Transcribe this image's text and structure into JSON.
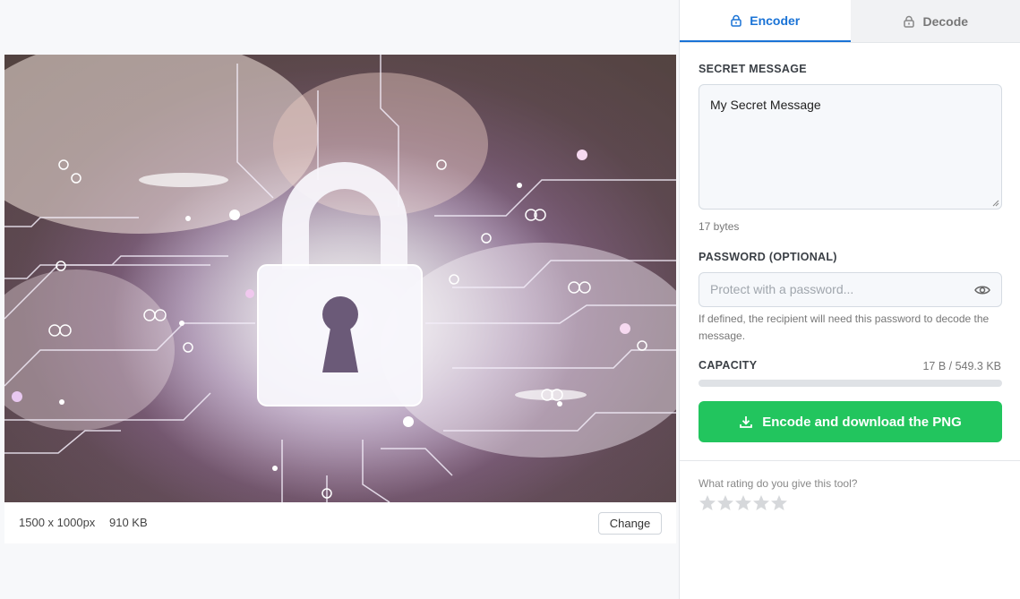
{
  "preview": {
    "dimensions": "1500 x 1000px",
    "file_size": "910 KB",
    "change_label": "Change"
  },
  "tabs": {
    "encoder": "Encoder",
    "decode": "Decode",
    "active": "encoder"
  },
  "encoder": {
    "secret_label": "SECRET MESSAGE",
    "secret_value": "My Secret Message",
    "byte_count": "17 bytes",
    "password_label": "PASSWORD (OPTIONAL)",
    "password_placeholder": "Protect with a password...",
    "password_help": "If defined, the recipient will need this password to decode the message.",
    "capacity_label": "CAPACITY",
    "capacity_value": "17 B / 549.3 KB",
    "capacity_fraction": 3e-05,
    "encode_button": "Encode and download the PNG"
  },
  "rating": {
    "question": "What rating do you give this tool?",
    "stars": 5
  },
  "colors": {
    "accent": "#1a73d6",
    "success": "#22c55e"
  },
  "icons": {
    "tab_encoder": "lock-icon",
    "tab_decode": "lock-icon",
    "password_toggle": "eye-icon",
    "encode": "download-icon",
    "rating": "star-icon"
  }
}
